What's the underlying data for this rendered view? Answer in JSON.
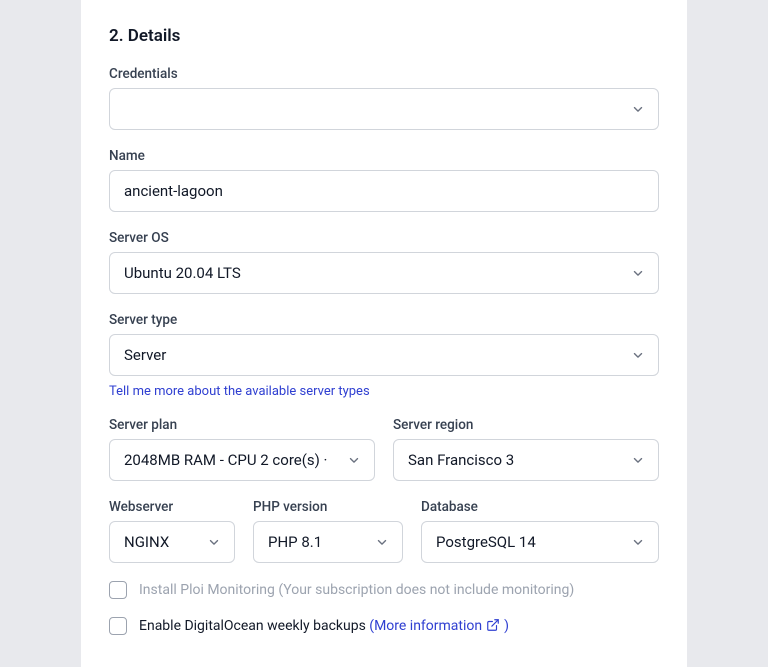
{
  "section": {
    "heading": "2. Details"
  },
  "fields": {
    "credentials": {
      "label": "Credentials",
      "value": ""
    },
    "name": {
      "label": "Name",
      "value": "ancient-lagoon"
    },
    "server_os": {
      "label": "Server OS",
      "value": "Ubuntu 20.04 LTS"
    },
    "server_type": {
      "label": "Server type",
      "value": "Server",
      "help_text": "Tell me more about the available server types"
    },
    "server_plan": {
      "label": "Server plan",
      "value": "2048MB RAM - CPU 2 core(s) · "
    },
    "server_region": {
      "label": "Server region",
      "value": "San Francisco 3"
    },
    "webserver": {
      "label": "Webserver",
      "value": "NGINX"
    },
    "php_version": {
      "label": "PHP version",
      "value": "PHP 8.1"
    },
    "database": {
      "label": "Database",
      "value": "PostgreSQL 14"
    }
  },
  "checkboxes": {
    "monitoring": {
      "label": "Install Ploi Monitoring (Your subscription does not include monitoring)"
    },
    "backups": {
      "label_prefix": "Enable DigitalOcean weekly backups ",
      "link_text": "(More information ",
      "link_suffix": ")"
    }
  }
}
